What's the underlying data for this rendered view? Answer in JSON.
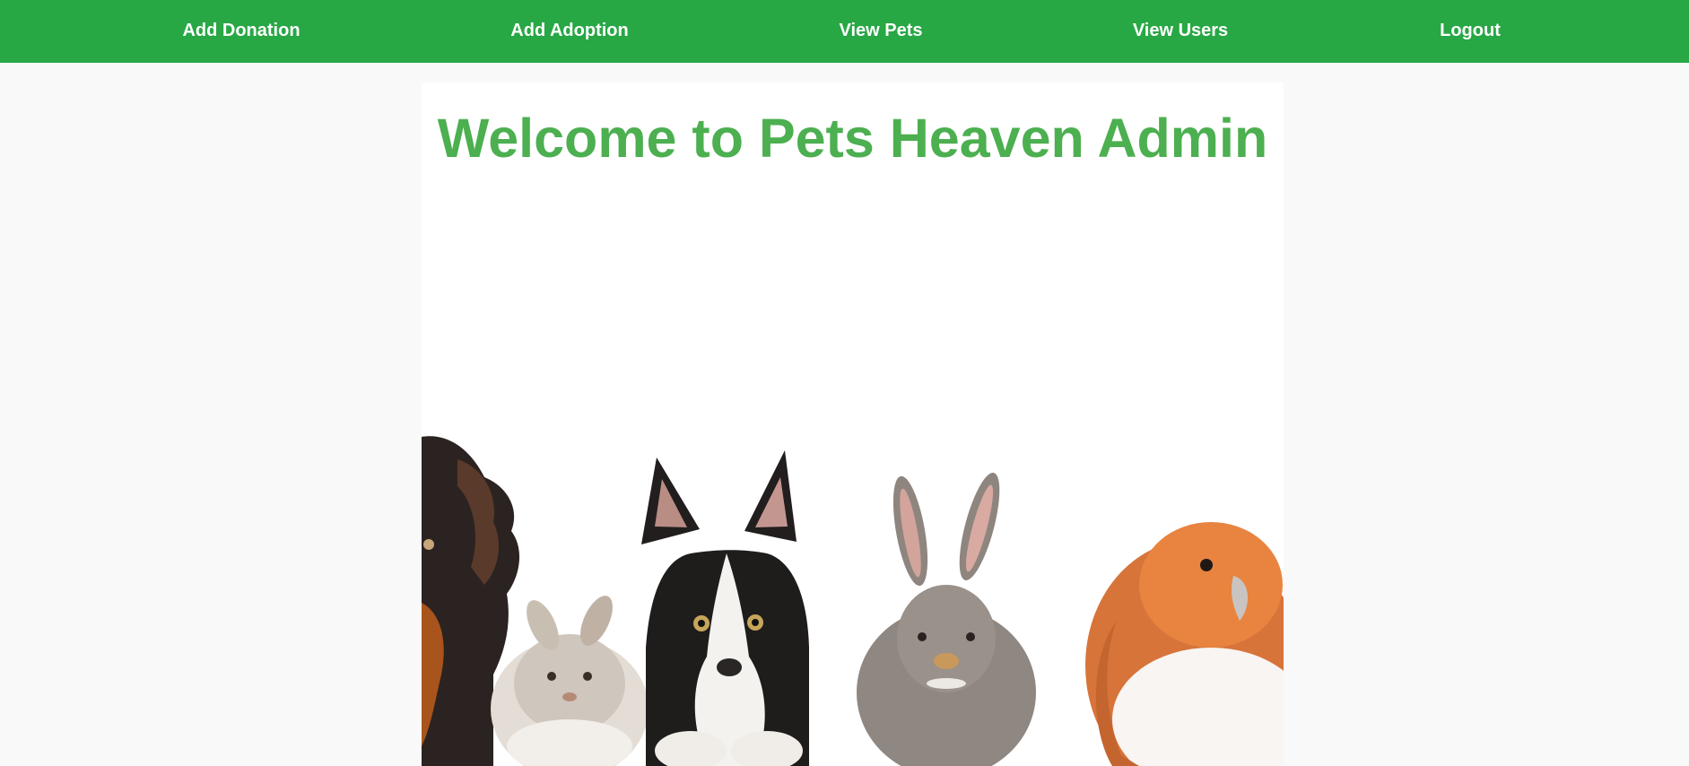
{
  "navbar": {
    "background": "#28a745",
    "items": [
      {
        "label": "Add Donation"
      },
      {
        "label": "Add Adoption"
      },
      {
        "label": "View Pets"
      },
      {
        "label": "View Users"
      },
      {
        "label": "Logout"
      }
    ]
  },
  "main": {
    "title": "Welcome to Pets Heaven Admin",
    "title_color": "#4caf50",
    "hero_image": {
      "subjects": [
        "dog",
        "bunny",
        "puppy",
        "rabbit",
        "bird"
      ]
    }
  }
}
